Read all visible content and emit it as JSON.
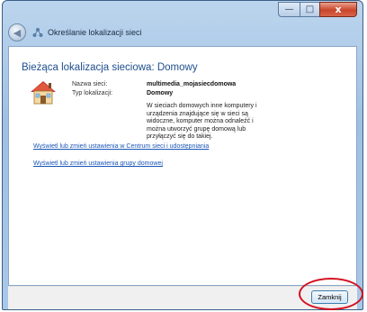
{
  "window": {
    "title": "Określanie lokalizacji sieci",
    "caption": {
      "minimize": "—",
      "maximize": "□",
      "close": "x"
    }
  },
  "icons": {
    "back": "back-arrow-icon",
    "network": "network-icon",
    "house": "home-network-icon"
  },
  "main": {
    "heading": "Bieżąca lokalizacja sieciowa: Domowy",
    "network_name_label": "Nazwa sieci:",
    "network_name_value": "multimedia_mojasiecdomowa",
    "location_type_label": "Typ lokalizacji:",
    "location_type_value": "Domowy",
    "description": "W sieciach domowych inne komputery i urządzenia znajdujące się w sieci są widoczne, komputer można odnaleźć i można utworzyć grupę domową lub przyłączyć się do takiej.",
    "link_sharing_center": "Wyświetl lub zmień ustawienia w Centrum sieci i udostępniania",
    "link_homegroup": "Wyświetl lub zmień ustawienia grupy domowej"
  },
  "footer": {
    "close_label": "Zamknij"
  },
  "colors": {
    "heading": "#1f4f8f",
    "link": "#1a56b8",
    "highlight": "#d40f1f"
  }
}
